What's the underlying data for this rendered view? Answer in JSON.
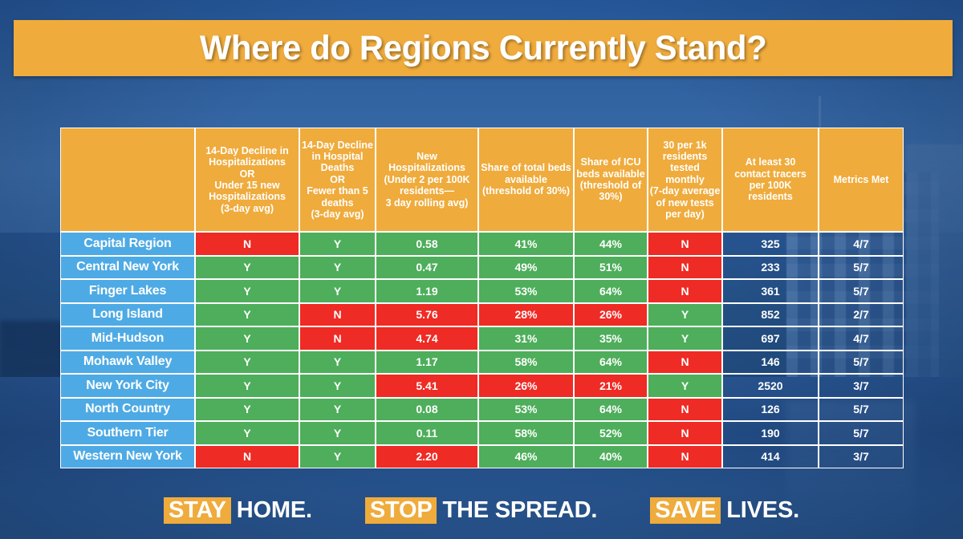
{
  "title": "Where do Regions Currently Stand?",
  "colors": {
    "accent_orange": "#efab3c",
    "region_blue": "#4eaae4",
    "pass_green": "#4eae5b",
    "fail_red": "#ee2b24",
    "background_blue": "#2b5b99",
    "text_white": "#ffffff"
  },
  "table": {
    "columns": [
      "",
      "14-Day Decline in Hospitalizations\nOR\nUnder 15 new Hospitalizations\n(3-day avg)",
      "14-Day Decline in Hospital Deaths\nOR\nFewer than 5 deaths\n(3-day avg)",
      "New Hospitalizations\n(Under 2 per 100K residents—\n3 day rolling avg)",
      "Share of total beds available\n(threshold of 30%)",
      "Share of ICU beds available\n(threshold of 30%)",
      "30 per 1k residents tested monthly\n(7-day average of new tests per day)",
      "At least 30 contact tracers per 100K residents",
      "Metrics Met"
    ],
    "column_lines": [
      [],
      [
        "14-Day Decline in",
        "Hospitalizations",
        "OR",
        "Under 15 new",
        "Hospitalizations",
        "(3-day avg)"
      ],
      [
        "14-Day Decline",
        "in Hospital",
        "Deaths",
        "OR",
        "Fewer than 5",
        "deaths",
        "(3-day avg)"
      ],
      [
        "New",
        "Hospitalizations",
        "(Under 2 per 100K",
        "residents—",
        "3 day rolling avg)"
      ],
      [
        "Share of total beds",
        "available",
        "(threshold of 30%)"
      ],
      [
        "Share of ICU",
        "beds available",
        "(threshold of",
        "30%)"
      ],
      [
        "30 per 1k",
        "residents",
        "tested",
        "monthly",
        "(7-day average",
        "of new tests",
        "per day)"
      ],
      [
        "At least 30",
        "contact tracers",
        "per 100K",
        "residents"
      ],
      [
        "Metrics Met"
      ]
    ],
    "rows": [
      {
        "region": "Capital Region",
        "cells": [
          {
            "value": "N",
            "state": "no"
          },
          {
            "value": "Y",
            "state": "yes"
          },
          {
            "value": "0.58",
            "state": "yes"
          },
          {
            "value": "41%",
            "state": "yes"
          },
          {
            "value": "44%",
            "state": "yes"
          },
          {
            "value": "N",
            "state": "no"
          },
          {
            "value": "325",
            "state": "plain"
          },
          {
            "value": "4/7",
            "state": "plain"
          }
        ]
      },
      {
        "region": "Central New York",
        "cells": [
          {
            "value": "Y",
            "state": "yes"
          },
          {
            "value": "Y",
            "state": "yes"
          },
          {
            "value": "0.47",
            "state": "yes"
          },
          {
            "value": "49%",
            "state": "yes"
          },
          {
            "value": "51%",
            "state": "yes"
          },
          {
            "value": "N",
            "state": "no"
          },
          {
            "value": "233",
            "state": "plain"
          },
          {
            "value": "5/7",
            "state": "plain"
          }
        ]
      },
      {
        "region": "Finger Lakes",
        "cells": [
          {
            "value": "Y",
            "state": "yes"
          },
          {
            "value": "Y",
            "state": "yes"
          },
          {
            "value": "1.19",
            "state": "yes"
          },
          {
            "value": "53%",
            "state": "yes"
          },
          {
            "value": "64%",
            "state": "yes"
          },
          {
            "value": "N",
            "state": "no"
          },
          {
            "value": "361",
            "state": "plain"
          },
          {
            "value": "5/7",
            "state": "plain"
          }
        ]
      },
      {
        "region": "Long Island",
        "cells": [
          {
            "value": "Y",
            "state": "yes"
          },
          {
            "value": "N",
            "state": "no"
          },
          {
            "value": "5.76",
            "state": "no"
          },
          {
            "value": "28%",
            "state": "no"
          },
          {
            "value": "26%",
            "state": "no"
          },
          {
            "value": "Y",
            "state": "yes"
          },
          {
            "value": "852",
            "state": "plain"
          },
          {
            "value": "2/7",
            "state": "plain"
          }
        ]
      },
      {
        "region": "Mid-Hudson",
        "cells": [
          {
            "value": "Y",
            "state": "yes"
          },
          {
            "value": "N",
            "state": "no"
          },
          {
            "value": "4.74",
            "state": "no"
          },
          {
            "value": "31%",
            "state": "yes"
          },
          {
            "value": "35%",
            "state": "yes"
          },
          {
            "value": "Y",
            "state": "yes"
          },
          {
            "value": "697",
            "state": "plain"
          },
          {
            "value": "4/7",
            "state": "plain"
          }
        ]
      },
      {
        "region": "Mohawk Valley",
        "cells": [
          {
            "value": "Y",
            "state": "yes"
          },
          {
            "value": "Y",
            "state": "yes"
          },
          {
            "value": "1.17",
            "state": "yes"
          },
          {
            "value": "58%",
            "state": "yes"
          },
          {
            "value": "64%",
            "state": "yes"
          },
          {
            "value": "N",
            "state": "no"
          },
          {
            "value": "146",
            "state": "plain"
          },
          {
            "value": "5/7",
            "state": "plain"
          }
        ]
      },
      {
        "region": "New York City",
        "cells": [
          {
            "value": "Y",
            "state": "yes"
          },
          {
            "value": "Y",
            "state": "yes"
          },
          {
            "value": "5.41",
            "state": "no"
          },
          {
            "value": "26%",
            "state": "no"
          },
          {
            "value": "21%",
            "state": "no"
          },
          {
            "value": "Y",
            "state": "yes"
          },
          {
            "value": "2520",
            "state": "plain"
          },
          {
            "value": "3/7",
            "state": "plain"
          }
        ]
      },
      {
        "region": "North Country",
        "cells": [
          {
            "value": "Y",
            "state": "yes"
          },
          {
            "value": "Y",
            "state": "yes"
          },
          {
            "value": "0.08",
            "state": "yes"
          },
          {
            "value": "53%",
            "state": "yes"
          },
          {
            "value": "64%",
            "state": "yes"
          },
          {
            "value": "N",
            "state": "no"
          },
          {
            "value": "126",
            "state": "plain"
          },
          {
            "value": "5/7",
            "state": "plain"
          }
        ]
      },
      {
        "region": "Southern Tier",
        "cells": [
          {
            "value": "Y",
            "state": "yes"
          },
          {
            "value": "Y",
            "state": "yes"
          },
          {
            "value": "0.11",
            "state": "yes"
          },
          {
            "value": "58%",
            "state": "yes"
          },
          {
            "value": "52%",
            "state": "yes"
          },
          {
            "value": "N",
            "state": "no"
          },
          {
            "value": "190",
            "state": "plain"
          },
          {
            "value": "5/7",
            "state": "plain"
          }
        ]
      },
      {
        "region": "Western New York",
        "cells": [
          {
            "value": "N",
            "state": "no"
          },
          {
            "value": "Y",
            "state": "yes"
          },
          {
            "value": "2.20",
            "state": "no"
          },
          {
            "value": "46%",
            "state": "yes"
          },
          {
            "value": "40%",
            "state": "yes"
          },
          {
            "value": "N",
            "state": "no"
          },
          {
            "value": "414",
            "state": "plain"
          },
          {
            "value": "3/7",
            "state": "plain"
          }
        ]
      }
    ]
  },
  "slogan": [
    {
      "highlight": "STAY",
      "rest": "HOME."
    },
    {
      "highlight": "STOP",
      "rest": "THE SPREAD."
    },
    {
      "highlight": "SAVE",
      "rest": "LIVES."
    }
  ]
}
